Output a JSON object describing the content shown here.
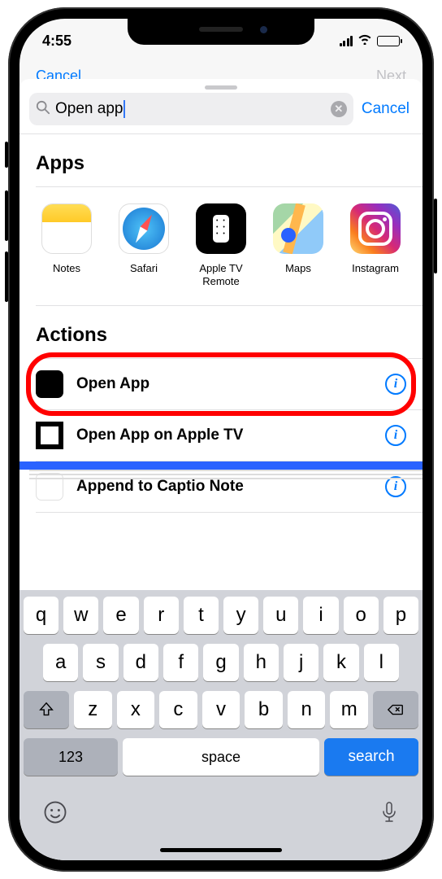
{
  "status": {
    "time": "4:55"
  },
  "peek": {
    "left_partial": "Cancel",
    "right_partial": "Next"
  },
  "search": {
    "value": "Open app",
    "cancel": "Cancel"
  },
  "sections": {
    "apps": "Apps",
    "actions": "Actions"
  },
  "apps": [
    {
      "label": "Notes"
    },
    {
      "label": "Safari"
    },
    {
      "label": "Apple TV Remote"
    },
    {
      "label": "Maps"
    },
    {
      "label": "Instagram"
    }
  ],
  "actions": [
    {
      "label": "Open App"
    },
    {
      "label": "Open App on Apple TV"
    },
    {
      "label": "Append to Captio Note"
    }
  ],
  "keyboard": {
    "row1": [
      "q",
      "w",
      "e",
      "r",
      "t",
      "y",
      "u",
      "i",
      "o",
      "p"
    ],
    "row2": [
      "a",
      "s",
      "d",
      "f",
      "g",
      "h",
      "j",
      "k",
      "l"
    ],
    "row3": [
      "z",
      "x",
      "c",
      "v",
      "b",
      "n",
      "m"
    ],
    "num": "123",
    "space": "space",
    "action": "search"
  }
}
